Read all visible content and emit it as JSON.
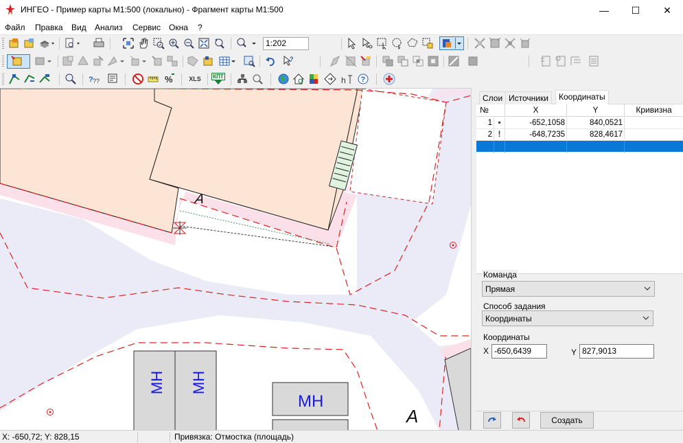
{
  "window": {
    "title": "ИНГЕО - Пример карты М1:500 (локально) - Фрагмент карты М1:500",
    "app_icon": "ingeo-logo-icon",
    "minimize_glyph": "—",
    "maximize_glyph": "☐",
    "close_glyph": "✕"
  },
  "menu": [
    "Файл",
    "Правка",
    "Вид",
    "Анализ",
    "Сервис",
    "Окна",
    "?"
  ],
  "toolbar": {
    "scale_value": "1:202",
    "xls_label": "XLS",
    "kpt_label": "КПТ"
  },
  "map": {
    "labels": {
      "letter_a_top": "А",
      "letter_a_bottom": "А",
      "mn_1": "МН",
      "mn_2": "МН",
      "mn_3": "МН"
    },
    "colors": {
      "building_fill": "#fde5d5",
      "road_fill": "#ebebf8",
      "pavement_fill": "#fbe0ea",
      "boundary_red": "#e02020",
      "garage_fill": "#d9d9d9",
      "label_blue": "#1a1ae0"
    }
  },
  "panel": {
    "tabs": [
      {
        "label": "Слои",
        "active": false
      },
      {
        "label": "Источники",
        "active": false
      },
      {
        "label": "Координаты",
        "active": true
      }
    ],
    "grid": {
      "columns": [
        "№",
        "X",
        "Y",
        "Кривизна"
      ],
      "rows": [
        {
          "n": "1",
          "mark": "▪",
          "x": "-652,1058",
          "y": "840,0521",
          "curv": ""
        },
        {
          "n": "2",
          "mark": "!",
          "x": "-648,7235",
          "y": "828,4617",
          "curv": ""
        },
        {
          "n": "",
          "mark": "",
          "x": "",
          "y": "",
          "curv": "",
          "selected": true
        }
      ]
    },
    "command_label": "Команда",
    "command_value": "Прямая",
    "method_label": "Способ задания",
    "method_value": "Координаты",
    "coords_label": "Координаты",
    "x_label": "X",
    "x_value": "-650,6439",
    "y_label": "Y",
    "y_value": "827,9013",
    "create_label": "Создать"
  },
  "status": {
    "coords": "X: -650,72; Y: 828,15",
    "snap": "Привязка: Отмостка (площадь)"
  }
}
